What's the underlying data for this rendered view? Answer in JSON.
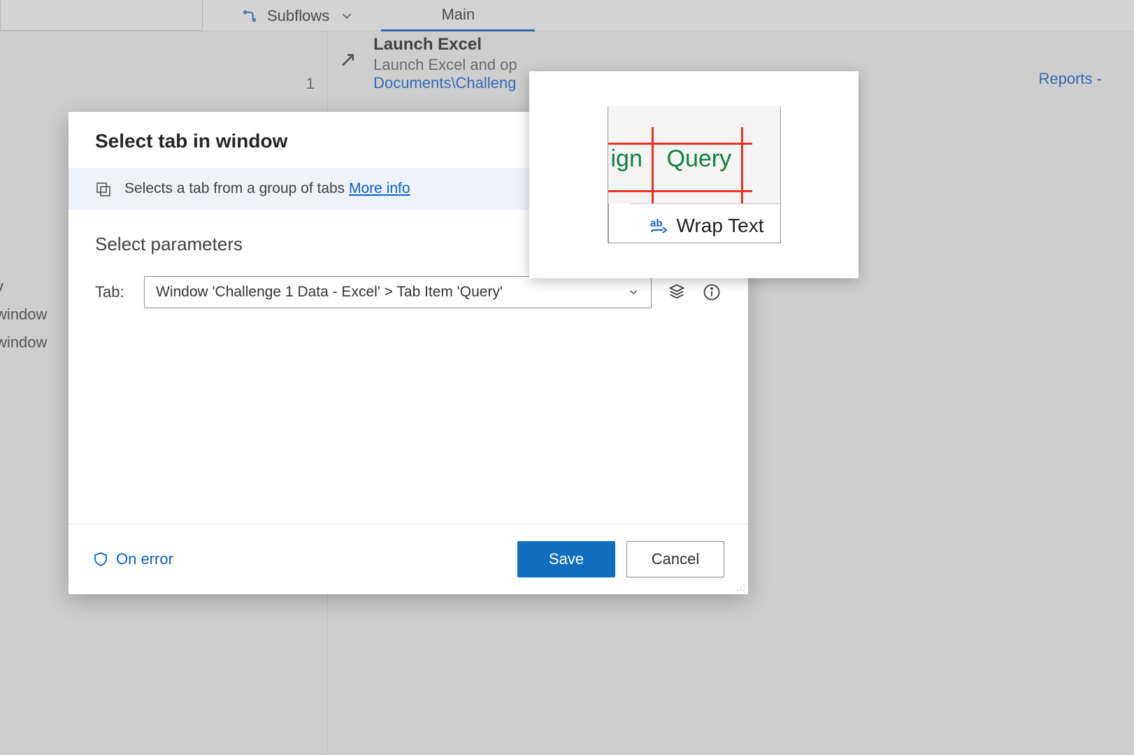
{
  "toolbar": {
    "subflows_label": "Subflows",
    "tab_main": "Main"
  },
  "bg_action": {
    "line_number": "1",
    "title": "Launch Excel",
    "subtitle_visible": "Launch Excel and op",
    "path_visible": "Documents\\Challeng",
    "reports_fragment": "Reports -"
  },
  "side_peek": {
    "line1": "v",
    "line2": "window",
    "line3": "window"
  },
  "dialog": {
    "title": "Select tab in window",
    "info_text": "Selects a tab from a group of tabs ",
    "more_info": "More info",
    "section_label": "Select parameters",
    "param_label": "Tab:",
    "tab_value": "Window 'Challenge 1 Data - Excel'  >  Tab Item 'Query'",
    "on_error": "On error",
    "save": "Save",
    "cancel": "Cancel"
  },
  "thumbnail": {
    "left_tab_fragment": "ign",
    "right_tab": "Query",
    "wrap_text": "Wrap Text"
  }
}
